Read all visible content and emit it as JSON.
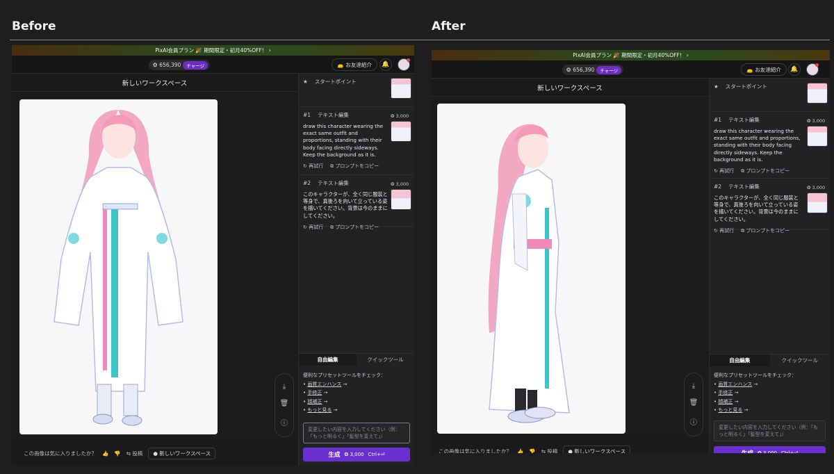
{
  "labels": {
    "before": "Before",
    "after": "After"
  },
  "promo": {
    "text": "PixAI会員プラン 🎉 期間限定・初月40%OFF！ ›"
  },
  "topbar": {
    "credits": "656,390",
    "charge": "チャージ",
    "invite": "お友達紹介"
  },
  "workspace": {
    "title": "新しいワークスペース"
  },
  "start_point": {
    "label": "スタートポイント"
  },
  "entries": [
    {
      "num": "#1",
      "type": "テキスト編集",
      "cost": "3,000",
      "prompt": "draw this character wearing the exact same outfit and proportions, standing with their body facing directly sideways. Keep the background as it is.",
      "retry": "再試行",
      "copy": "プロンプトをコピー"
    },
    {
      "num": "#2",
      "type": "テキスト編集",
      "cost": "3,000",
      "prompt": "このキャラクターが、全く同じ服装と等身で、真後ろを向いて立っている姿を描いてください。背景は今のままにしてください。",
      "retry": "再試行",
      "copy": "プロンプトをコピー"
    }
  ],
  "tabs": {
    "free_edit": "自由編集",
    "quick_tool": "クイックツール"
  },
  "tips": {
    "intro": "便利なプリセットツールをチェック：",
    "items": [
      "画質エンハンス",
      "手修正",
      "顔補正",
      "もっと見る"
    ]
  },
  "input": {
    "placeholder": "変更したい内容を入力してください（例：「もっと明るく」「髪型を変えて」）"
  },
  "generate": {
    "label": "生成",
    "cost": "3,000",
    "shortcut": "Ctrl+⏎"
  },
  "feedback": {
    "question": "この画像は気に入りましたか？",
    "post": "投稿",
    "new_ws": "新しいワークスペース"
  },
  "colors": {
    "accent": "#6a2fd0",
    "hair": "#f0a8c0",
    "teal": "#3fc3c8"
  }
}
